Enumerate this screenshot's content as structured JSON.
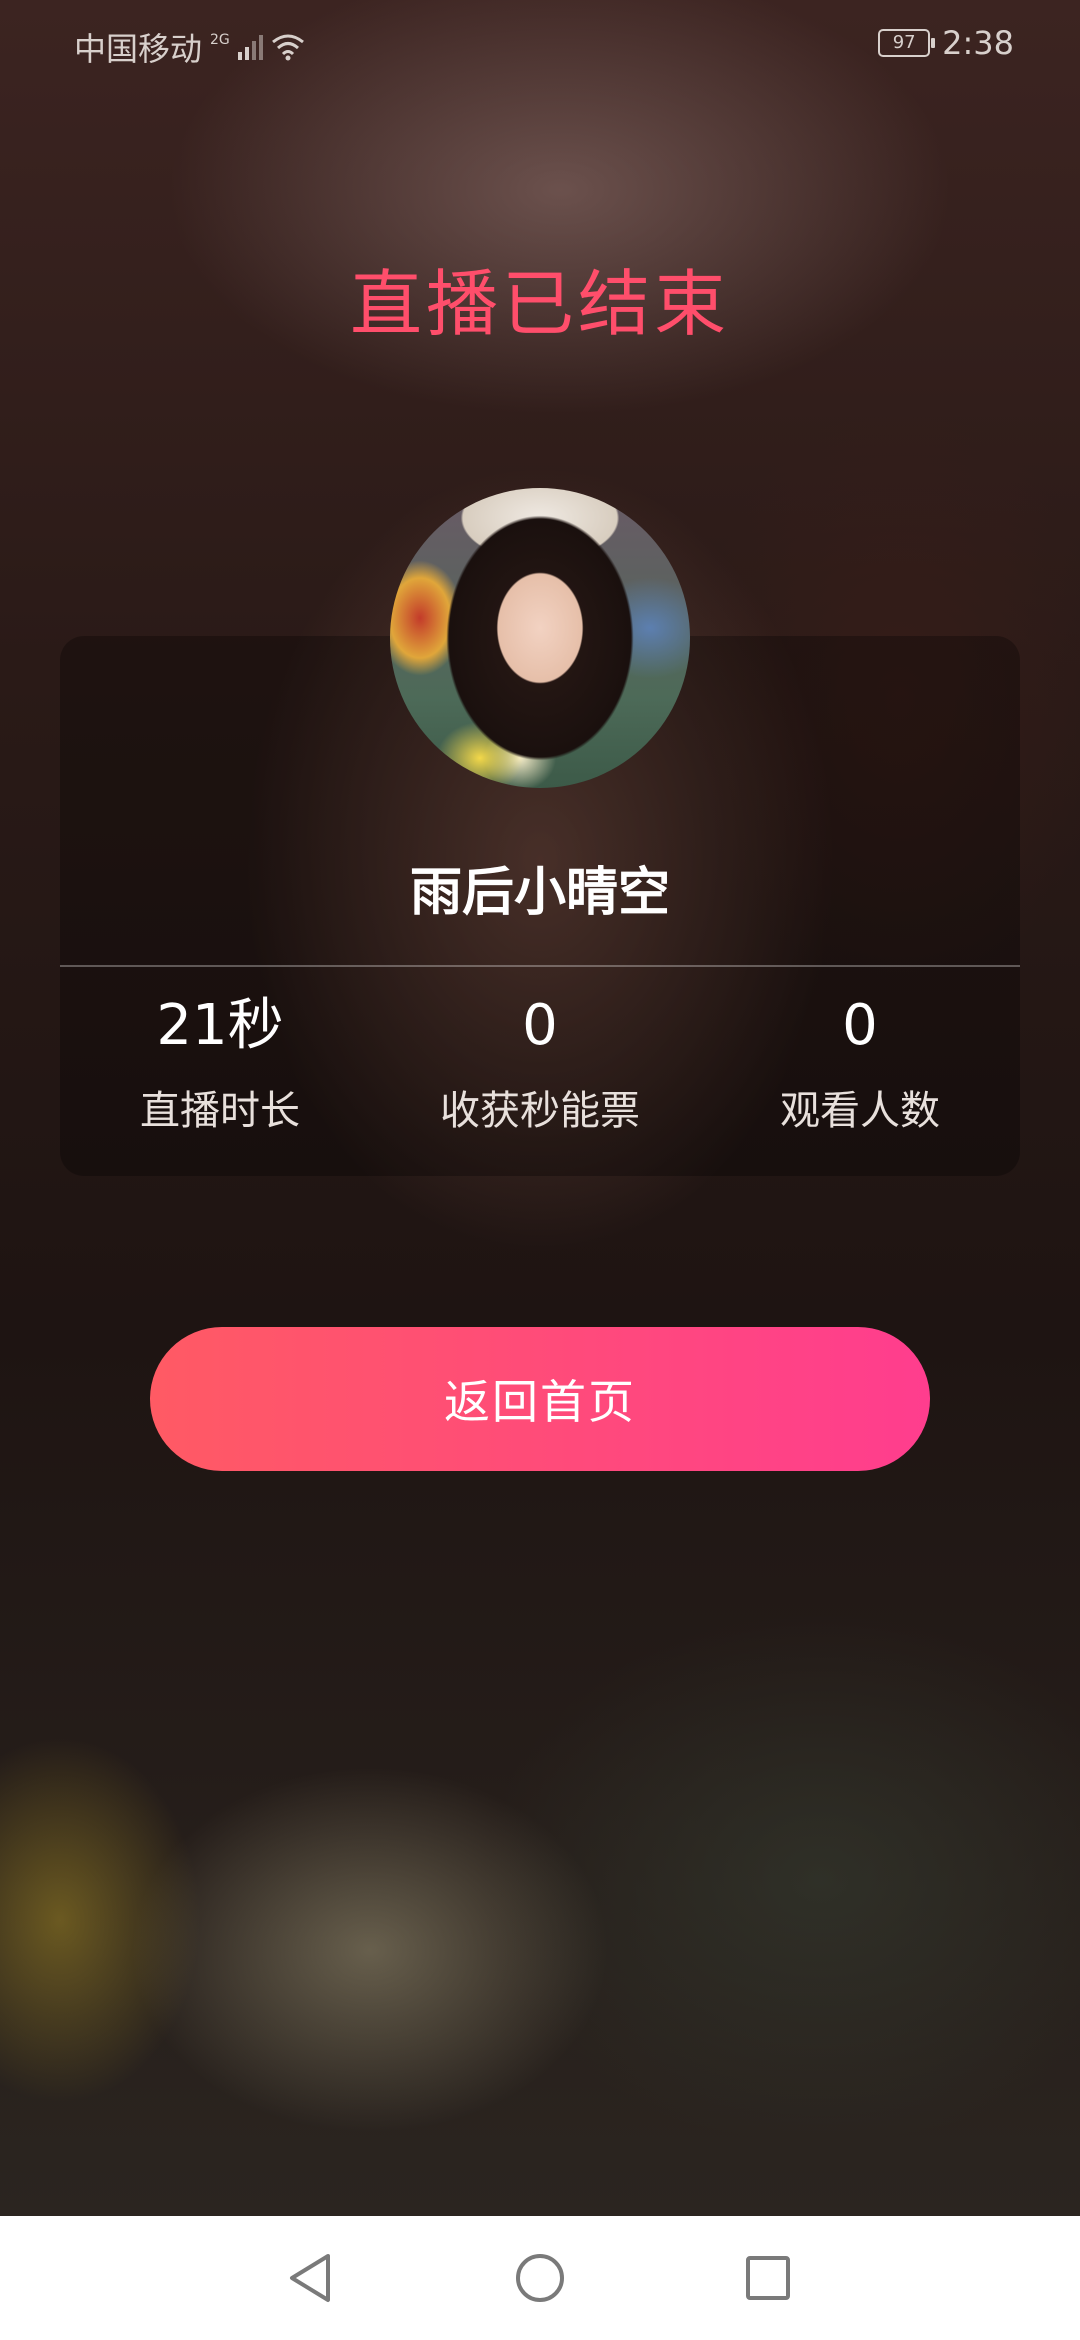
{
  "status_bar": {
    "carrier": "中国移动",
    "network_type": "2G",
    "battery_level": "97",
    "time": "2:38"
  },
  "page": {
    "title": "直播已结束"
  },
  "streamer": {
    "name": "雨后小晴空"
  },
  "stats": [
    {
      "value": "21秒",
      "label": "直播时长"
    },
    {
      "value": "0",
      "label": "收获秒能票"
    },
    {
      "value": "0",
      "label": "观看人数"
    }
  ],
  "actions": {
    "back_home_label": "返回首页"
  },
  "nav_bar": {
    "back_icon": "back-triangle-icon",
    "home_icon": "home-circle-icon",
    "recents_icon": "recents-square-icon"
  },
  "colors": {
    "title": "#ff4e6b",
    "button_gradient_start": "#ff5a64",
    "button_gradient_end": "#ff3d8e"
  }
}
